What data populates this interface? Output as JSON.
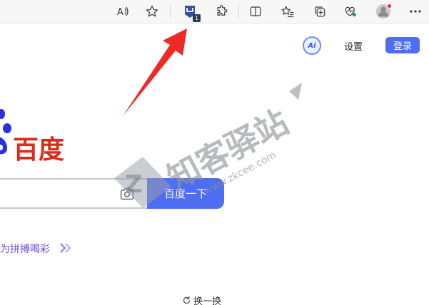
{
  "browser": {
    "toolbar_icons": [
      {
        "name": "read-aloud-icon",
        "glyph": "Aˢ"
      },
      {
        "name": "favorite-star-icon",
        "glyph": "☆"
      },
      {
        "name": "extension-icon-active",
        "badge": "1"
      },
      {
        "name": "extensions-puzzle-icon"
      },
      {
        "name": "split-screen-icon"
      },
      {
        "name": "favorites-list-icon"
      },
      {
        "name": "collections-icon"
      },
      {
        "name": "browser-essentials-icon"
      },
      {
        "name": "profile-avatar-icon"
      },
      {
        "name": "more-menu-icon",
        "glyph": "···"
      }
    ]
  },
  "header": {
    "ai_label": "Ai",
    "settings": "设置",
    "login": "登录"
  },
  "logo": {
    "text": "百度",
    "brand_color": "#de2a18",
    "paw_color": "#2932e1"
  },
  "search": {
    "button_label": "百度一下",
    "value": "",
    "button_color": "#4e6ef2"
  },
  "hot": {
    "text": "为拼搏喝彩"
  },
  "refresh": {
    "label": "换一换"
  },
  "watermark": {
    "text": "知客驿站",
    "url": "www.zkcee.com"
  }
}
